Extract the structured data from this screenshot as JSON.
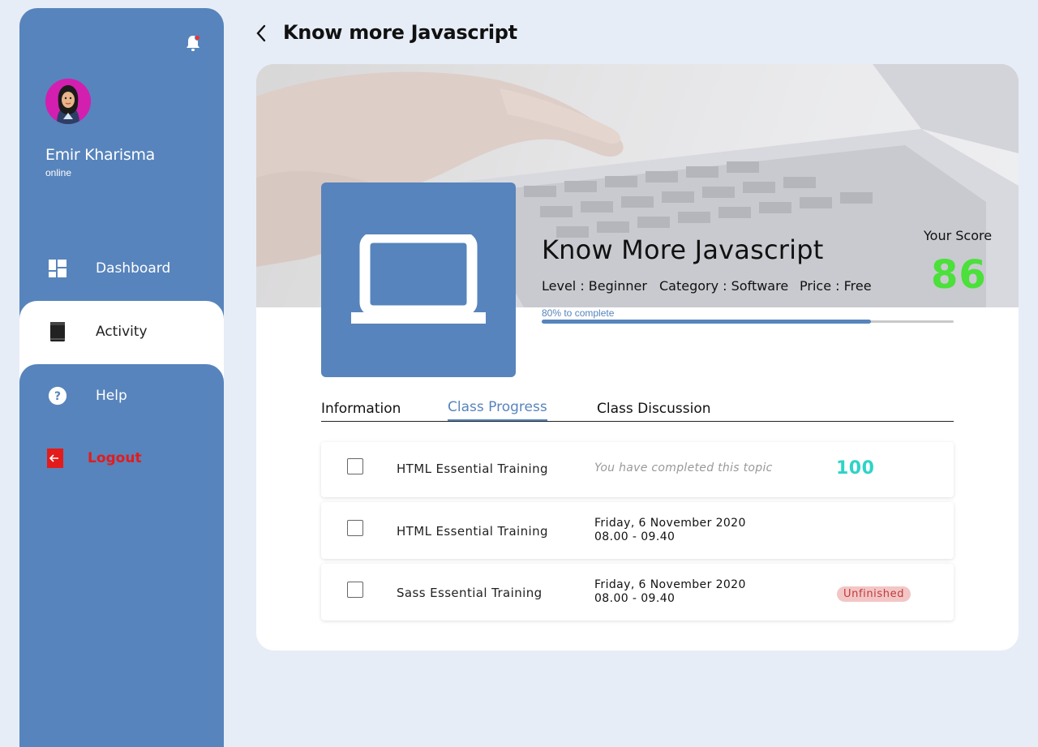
{
  "sidebar": {
    "user": {
      "name": "Emir Kharisma",
      "status": "online"
    },
    "items": [
      {
        "label": "Dashboard",
        "icon": "dashboard-grid-icon"
      },
      {
        "label": "Activity",
        "icon": "book-icon"
      },
      {
        "label": "Help",
        "icon": "question-circle-icon"
      },
      {
        "label": "Logout",
        "icon": "logout-icon"
      }
    ],
    "colors": {
      "background": "#5784bc",
      "active_background": "#ffffff",
      "logout": "#e41b1b"
    }
  },
  "header": {
    "title": "Know more Javascript"
  },
  "course": {
    "title": "Know More Javascript",
    "level": "Level : Beginner",
    "category": "Category : Software",
    "price": "Price : Free",
    "score_label": "Your Score",
    "score": "86",
    "progress_text": "80% to complete",
    "progress": 0.8
  },
  "tabs": [
    {
      "label": "Information",
      "active": false
    },
    {
      "label": "Class Progress",
      "active": true
    },
    {
      "label": "Class Discussion",
      "active": false
    }
  ],
  "topics": [
    {
      "name": "HTML Essential Training",
      "note": "You have completed this topic",
      "score": "100",
      "checked": false
    },
    {
      "name": "HTML Essential Training",
      "date": "Friday, 6 November 2020",
      "time": "08.00 - 09.40",
      "checked": false
    },
    {
      "name": "Sass Essential Training",
      "date": "Friday, 6 November 2020",
      "time": "08.00 - 09.40",
      "status": "Unfinished",
      "checked": false
    }
  ],
  "colors": {
    "accent": "#5784bc",
    "score": "#4be03a",
    "topic_score": "#2dd4c7",
    "badge_text": "#c03a3a",
    "badge_bg": "#f3c6c6"
  }
}
